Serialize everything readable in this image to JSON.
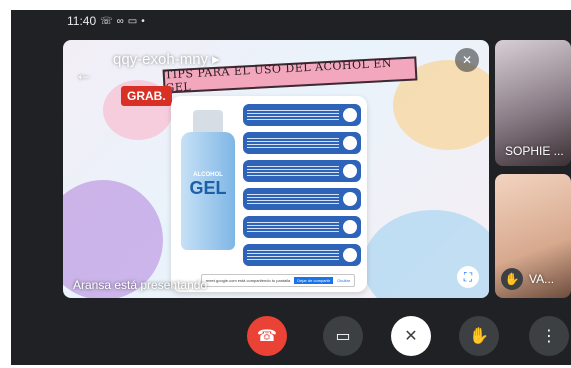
{
  "status_bar": {
    "time": "11:40",
    "icons": [
      "whatsapp-icon",
      "voicemail-icon",
      "video-icon",
      "dot-icon"
    ]
  },
  "meeting": {
    "code": "qqy-exoh-mny",
    "recording_label": "GRAB.",
    "presenting_text": "Aransa está presentando"
  },
  "slide": {
    "banner_title": "TIPS PARA EL USO DEL ACOHOL EN GEL",
    "bottle_label_small": "ALCOHOL",
    "bottle_label_big": "GEL",
    "share_bar": {
      "message": "meet.google.com está compartiendo tu pantalla",
      "stop_label": "Dejar de compartir",
      "hide_label": "Ocultar"
    }
  },
  "participants": [
    {
      "name": "SOPHIE ..."
    },
    {
      "name": "VA..."
    }
  ],
  "controls": {
    "end_call": "call-end-icon",
    "camera": "video-camera-icon",
    "mic": "mic-off-icon",
    "hand": "raise-hand-icon",
    "more": "more-vert-icon"
  },
  "colors": {
    "end_call": "#ea4335",
    "recording": "#d93025",
    "control_bg": "#3c4043",
    "screen_bg": "#202124"
  }
}
